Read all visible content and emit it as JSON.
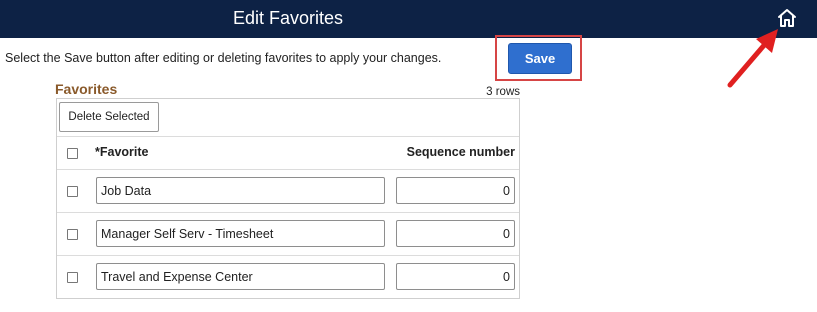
{
  "header": {
    "title": "Edit Favorites",
    "home_icon": "home-icon"
  },
  "instructions": "Select the Save button after editing or deleting favorites to apply your changes.",
  "save_label": "Save",
  "favorites": {
    "title": "Favorites",
    "row_count": "3 rows",
    "delete_label": "Delete Selected",
    "columns": {
      "favorite": "*Favorite",
      "sequence": "Sequence number"
    },
    "rows": [
      {
        "favorite": "Job Data",
        "sequence": "0"
      },
      {
        "favorite": "Manager Self Serv - Timesheet",
        "sequence": "0"
      },
      {
        "favorite": "Travel and Expense Center",
        "sequence": "0"
      }
    ]
  },
  "colors": {
    "header_bg": "#0d2245",
    "save_bg": "#2f6fcf",
    "highlight": "#d64545",
    "section_title": "#8a5a2b"
  }
}
